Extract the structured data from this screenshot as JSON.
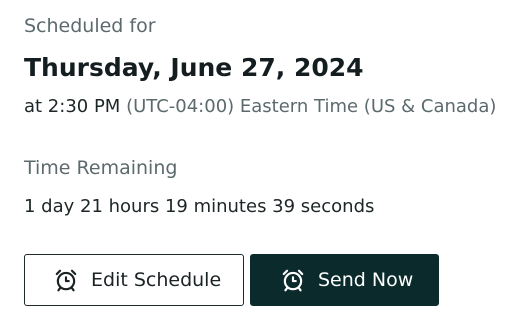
{
  "schedule": {
    "heading": "Scheduled for",
    "date": "Thursday, June 27, 2024",
    "time": "at 2:30 PM",
    "timezone": "(UTC-04:00) Eastern Time (US & Canada)"
  },
  "remaining": {
    "heading": "Time Remaining",
    "value": "1 day 21 hours 19 minutes 39 seconds"
  },
  "actions": {
    "edit_label": "Edit Schedule",
    "send_label": "Send Now",
    "edit_icon": "alarm-clock-icon",
    "send_icon": "alarm-clock-icon"
  },
  "colors": {
    "primary_button": "#0b2a2c",
    "secondary_text": "#5c6a6d"
  }
}
